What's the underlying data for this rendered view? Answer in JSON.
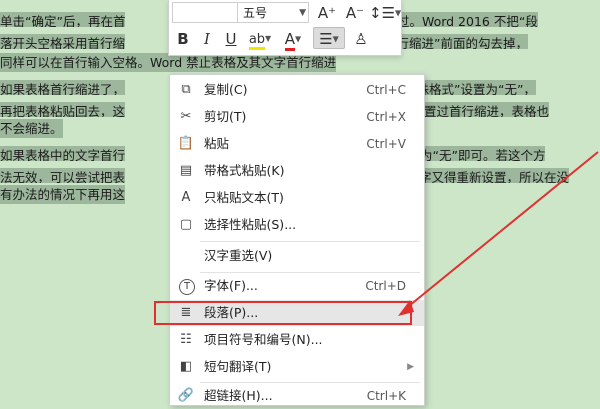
{
  "document": {
    "lines": [
      {
        "a": "单击“确定”后，再在首",
        "b": "了。不过。Word 2016  不把“段"
      },
      {
        "a": "落开头空格采用首行缩",
        "b": "进和首行缩进”前面的勾去掉，"
      },
      {
        "a": "同样可以在首行输入空格。Word  禁止表格及其文字首行缩进",
        "b": ""
      },
      {
        "a": "如果表格首行缩进了，",
        "b": "把“特殊格式”设置为“无”，"
      },
      {
        "a": "再把表格粘贴回去，这",
        "b": "使设置过首行缩进，表格也"
      },
      {
        "a": "不会缩进。",
        "b": ""
      },
      {
        "a": "如果表格中的文字首行",
        "b": "设置为“无”即可。若这个方"
      },
      {
        "a": "法无效，可以尝试把表",
        "b": "字又得重新设置，所以在没"
      },
      {
        "a": "有办法的情况下再用这",
        "b": ""
      }
    ]
  },
  "toolbar": {
    "font_name": "",
    "font_size": "五号",
    "grow_font": "A⁺",
    "shrink_font": "A⁻",
    "line_spacing": "↕☰",
    "bold": "B",
    "italic": "I",
    "underline": "U",
    "highlight": "ab",
    "font_color": "A",
    "align": "☰",
    "format_painter": "♙"
  },
  "menu": {
    "items": [
      {
        "label": "复制(C)",
        "shortcut": "Ctrl+C",
        "icon": "copy-icon"
      },
      {
        "label": "剪切(T)",
        "shortcut": "Ctrl+X",
        "icon": "scissors-icon"
      },
      {
        "label": "粘贴",
        "shortcut": "Ctrl+V",
        "icon": "paste-icon"
      },
      {
        "label": "带格式粘贴(K)",
        "shortcut": "",
        "icon": "paste-format-icon"
      },
      {
        "label": "只粘贴文本(T)",
        "shortcut": "",
        "icon": "paste-text-icon"
      },
      {
        "label": "选择性粘贴(S)...",
        "shortcut": "",
        "icon": "paste-special-icon"
      },
      {
        "label": "汉字重选(V)",
        "shortcut": "",
        "icon": ""
      },
      {
        "label": "字体(F)...",
        "shortcut": "Ctrl+D",
        "icon": "font-icon"
      },
      {
        "label": "段落(P)...",
        "shortcut": "",
        "icon": "paragraph-icon"
      },
      {
        "label": "项目符号和编号(N)...",
        "shortcut": "",
        "icon": "list-icon"
      },
      {
        "label": "短句翻译(T)",
        "shortcut": "",
        "icon": "translate-icon"
      },
      {
        "label": "超链接(H)...",
        "shortcut": "Ctrl+K",
        "icon": "link-icon"
      }
    ]
  },
  "colors": {
    "page_bg": "#cde6c8",
    "selection": "#9cb79c",
    "annotation": "#e03030"
  }
}
